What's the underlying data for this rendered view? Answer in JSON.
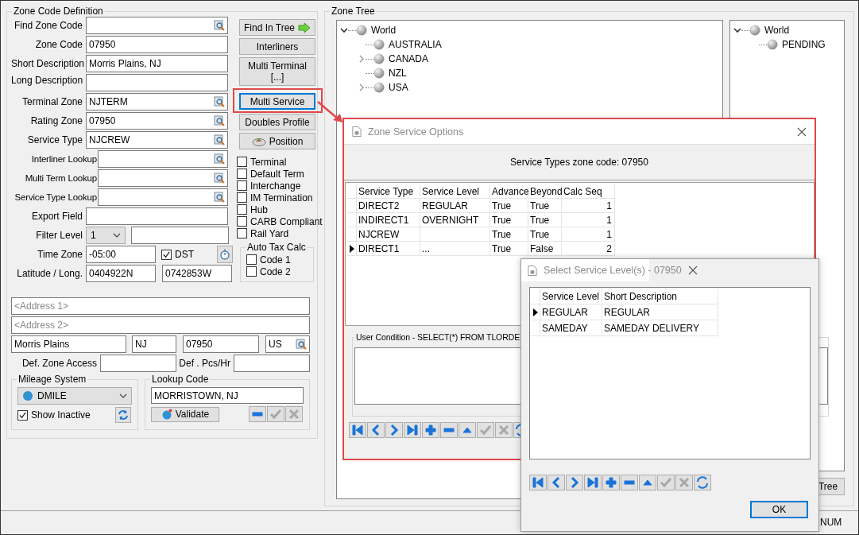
{
  "zone_code_definition": {
    "title": "Zone Code Definition",
    "fields": [
      {
        "label": "Find Zone Code",
        "kind": "lookup"
      },
      {
        "label": "Zone Code",
        "value": "07950",
        "kind": "text"
      },
      {
        "label": "Short Description",
        "value": "Morris Plains, NJ",
        "kind": "text"
      },
      {
        "label": "Long Description",
        "kind": "text"
      },
      {
        "label": "Terminal Zone",
        "value": "NJTERM",
        "kind": "lookup"
      },
      {
        "label": "Rating Zone",
        "value": "07950",
        "kind": "lookup"
      },
      {
        "label": "Service Type",
        "value": "NJCREW",
        "kind": "lookup"
      },
      {
        "label": "Interliner Lookup",
        "kind": "wide_lookup"
      },
      {
        "label": "Multi Term Lookup",
        "kind": "wide_lookup"
      },
      {
        "label": "Service Type Lookup",
        "kind": "wide_lookup"
      },
      {
        "label": "Export Field",
        "kind": "text"
      }
    ],
    "filter_level": {
      "label": "Filter Level",
      "value": "1"
    },
    "time_zone": {
      "label": "Time Zone",
      "value": "-05:00",
      "dst": {
        "label": "DST",
        "checked": true
      }
    },
    "lat_long": {
      "label": "Latitude / Long.",
      "latitude": "0404922N",
      "longitude": "0742853W"
    },
    "buttons": [
      {
        "label": "Find In Tree",
        "kind": "arrow",
        "focused": false,
        "highlighted": false
      },
      {
        "label": "Interliners",
        "kind": "plain",
        "focused": false,
        "highlighted": false
      },
      {
        "label": "Multi Terminal [...]",
        "kind": "plain",
        "focused": false,
        "highlighted": false
      },
      {
        "label": "Multi Service",
        "kind": "plain",
        "focused": true,
        "highlighted": true
      },
      {
        "label": "Doubles Profile",
        "kind": "plain",
        "focused": false,
        "highlighted": false
      },
      {
        "label": "Position",
        "kind": "position",
        "focused": false,
        "highlighted": false
      }
    ],
    "flags": [
      {
        "label": "Terminal",
        "checked": false
      },
      {
        "label": "Default Term",
        "checked": false
      },
      {
        "label": "Interchange",
        "checked": false
      },
      {
        "label": "IM Termination",
        "checked": false
      },
      {
        "label": "Hub",
        "checked": false
      },
      {
        "label": "CARB Compliant",
        "checked": false
      },
      {
        "label": "Rail Yard",
        "checked": false
      }
    ],
    "auto_tax_calc": {
      "title": "Auto Tax Calc",
      "options": [
        {
          "label": "Code 1",
          "checked": false
        },
        {
          "label": "Code 2",
          "checked": false
        }
      ]
    },
    "address": {
      "address1_placeholder": "<Address 1>",
      "address2_placeholder": "<Address 2>",
      "city": "Morris Plains",
      "state": "NJ",
      "zip": "07950",
      "country": "US"
    },
    "def_zone_access": {
      "label": "Def. Zone Access"
    },
    "def_pcs_hr": {
      "label": "Def . Pcs/Hr"
    },
    "mileage_system": {
      "title": "Mileage System",
      "value": "DMILE",
      "show_inactive": {
        "label": "Show Inactive",
        "checked": true
      }
    },
    "lookup_code": {
      "title": "Lookup Code",
      "value": "MORRISTOWN, NJ",
      "validate": "Validate",
      "tools": [
        {
          "kind": "delete",
          "disabled": false
        },
        {
          "kind": "post",
          "disabled": true
        },
        {
          "kind": "cancel",
          "disabled": true
        }
      ]
    }
  },
  "zone_tree": {
    "title": "Zone Tree",
    "trees": [
      [
        {
          "label": "World",
          "kind": "branch",
          "expanded": true,
          "children": [
            {
              "label": "AUSTRALIA",
              "kind": "leaf"
            },
            {
              "label": "CANADA",
              "kind": "branch",
              "expanded": false
            },
            {
              "label": "NZL",
              "kind": "leaf"
            },
            {
              "label": "USA",
              "kind": "branch",
              "expanded": false
            }
          ]
        }
      ],
      [
        {
          "label": "World",
          "kind": "branch",
          "expanded": true,
          "children": [
            {
              "label": "PENDING",
              "kind": "leaf"
            }
          ]
        }
      ]
    ],
    "button": "Tree"
  },
  "status_bar": {
    "num": "NUM"
  },
  "zone_service_options": {
    "title": "Zone Service Options",
    "header": "Service Types zone code: 07950",
    "highlighted": true,
    "columns": [
      "Service Type",
      "Service Level",
      "Advance",
      "Beyond",
      "Calc Seq"
    ],
    "rows": [
      {
        "cells": [
          "DIRECT2",
          "REGULAR",
          "True",
          "True",
          "1"
        ],
        "selected": false
      },
      {
        "cells": [
          "INDIRECT1",
          "OVERNIGHT",
          "True",
          "True",
          "1"
        ],
        "selected": false
      },
      {
        "cells": [
          "NJCREW",
          "",
          "True",
          "True",
          "1"
        ],
        "selected": false
      },
      {
        "cells": [
          "DIRECT1",
          "...",
          "True",
          "False",
          "2"
        ],
        "selected": true
      }
    ],
    "user_condition": "User Condition - SELECT(*) FROM TLORDE",
    "navigator": [
      {
        "kind": "first",
        "disabled": false
      },
      {
        "kind": "prior",
        "disabled": false
      },
      {
        "kind": "next",
        "disabled": false
      },
      {
        "kind": "last",
        "disabled": false
      },
      {
        "kind": "insert",
        "disabled": false
      },
      {
        "kind": "delete",
        "disabled": false
      },
      {
        "kind": "edit",
        "disabled": false
      },
      {
        "kind": "post",
        "disabled": true
      },
      {
        "kind": "cancel",
        "disabled": true
      },
      {
        "kind": "refresh",
        "disabled": false
      }
    ]
  },
  "select_service_levels": {
    "title": "Select Service Level(s) - 07950",
    "columns": [
      "Service Level",
      "Short Description"
    ],
    "rows": [
      {
        "cells": [
          "REGULAR",
          "REGULAR"
        ],
        "selected": true
      },
      {
        "cells": [
          "SAMEDAY",
          "SAMEDAY DELIVERY"
        ],
        "selected": false
      }
    ],
    "navigator": [
      {
        "kind": "first",
        "disabled": false
      },
      {
        "kind": "prior",
        "disabled": false
      },
      {
        "kind": "next",
        "disabled": false
      },
      {
        "kind": "last",
        "disabled": false
      },
      {
        "kind": "insert",
        "disabled": false
      },
      {
        "kind": "delete",
        "disabled": false
      },
      {
        "kind": "edit",
        "disabled": false
      },
      {
        "kind": "post",
        "disabled": true
      },
      {
        "kind": "cancel",
        "disabled": true
      },
      {
        "kind": "refresh",
        "disabled": false
      }
    ],
    "ok": "OK"
  }
}
